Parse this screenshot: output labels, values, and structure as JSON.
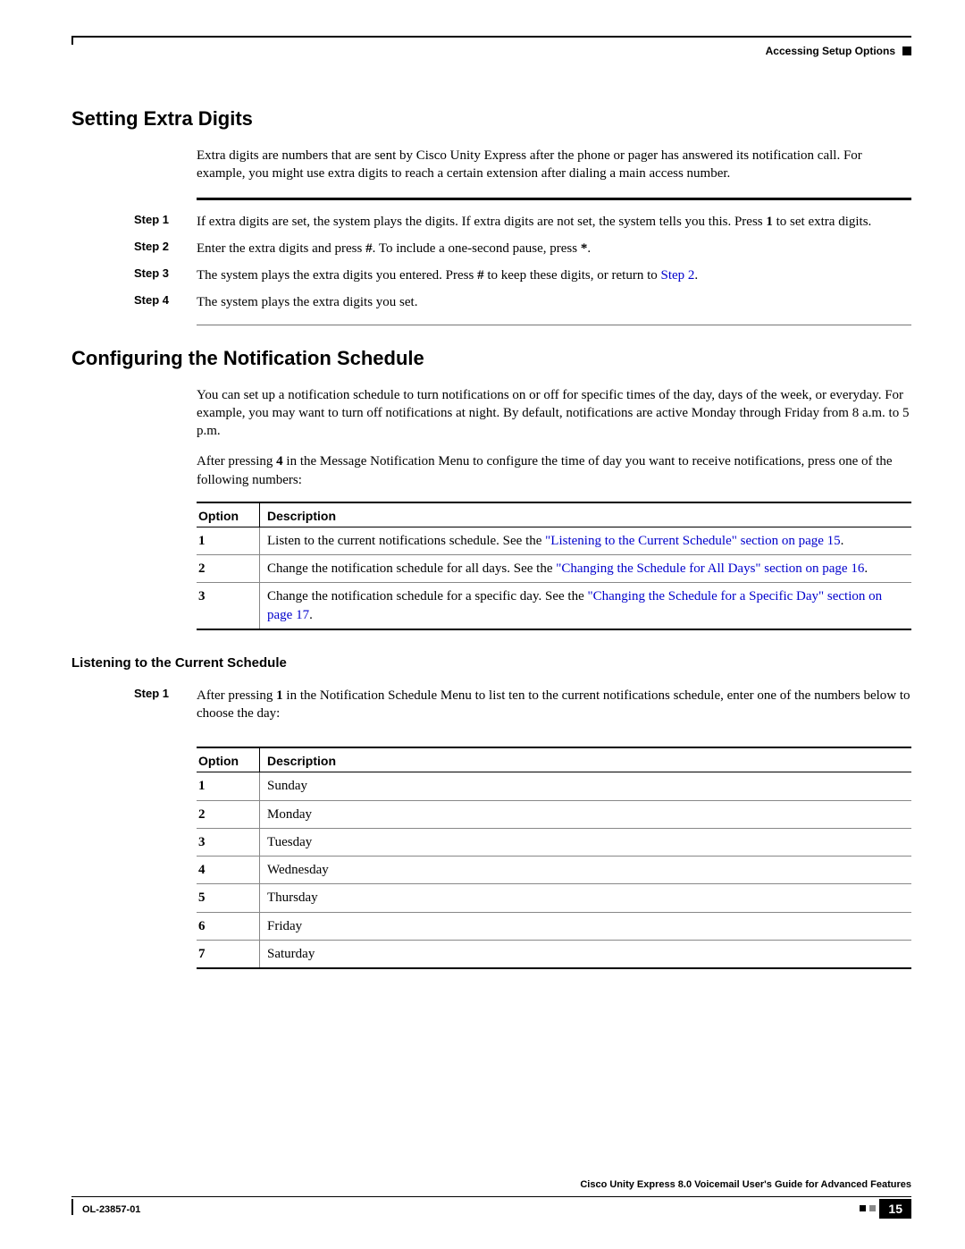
{
  "header": {
    "section": "Accessing Setup Options"
  },
  "h2a": "Setting Extra Digits",
  "p1": "Extra digits are numbers that are sent by Cisco Unity Express after the phone or pager has answered its notification call. For example, you might use extra digits to reach a certain extension after dialing a main access number.",
  "steps_a": {
    "prefix": "Step ",
    "s1": "If extra digits are set, the system plays the digits. If extra digits are not set, the system tells you this. Press 1 to set extra digits.",
    "s2": "Enter the extra digits and press #. To include a one-second pause, press *.",
    "s3_a": "The system plays the extra digits you entered. Press # to keep these digits, or return to ",
    "s3_link": "Step 2",
    "s3_b": ".",
    "s4": "The system plays the extra digits you set."
  },
  "h2b": "Configuring the Notification Schedule",
  "p2": "You can set up a notification schedule to turn notifications on or off for specific times of the day, days of the week, or everyday. For example, you may want to turn off notifications at night. By default, notifications are active Monday through Friday from 8 a.m. to 5 p.m.",
  "p3": "After pressing 4 in the Message Notification Menu to configure the time of day you want to receive notifications, press one of the following numbers:",
  "table1": {
    "h_option": "Option",
    "h_desc": "Description",
    "r1": {
      "opt": "1",
      "a": "Listen to the current notifications schedule. See the ",
      "link": "\"Listening to the Current Schedule\" section on page 15",
      "b": "."
    },
    "r2": {
      "opt": "2",
      "a": "Change the notification schedule for all days. See the ",
      "link": "\"Changing the Schedule for All Days\" section on page 16",
      "b": "."
    },
    "r3": {
      "opt": "3",
      "a": "Change the notification schedule for a specific day. See the ",
      "link": "\"Changing the Schedule for a Specific Day\" section on page 17",
      "b": "."
    }
  },
  "h3": "Listening to the Current Schedule",
  "step_b1": "After pressing 1 in the Notification Schedule Menu to listen to the current notifications schedule, enter one of the numbers below to choose the day:",
  "table2": {
    "h_option": "Option",
    "h_desc": "Description",
    "rows": [
      {
        "opt": "1",
        "desc": "Sunday"
      },
      {
        "opt": "2",
        "desc": "Monday"
      },
      {
        "opt": "3",
        "desc": "Tuesday"
      },
      {
        "opt": "4",
        "desc": "Wednesday"
      },
      {
        "opt": "5",
        "desc": "Thursday"
      },
      {
        "opt": "6",
        "desc": "Friday"
      },
      {
        "opt": "7",
        "desc": "Saturday"
      }
    ]
  },
  "footer": {
    "title": "Cisco Unity Express 8.0 Voicemail User's Guide for Advanced Features",
    "docid": "OL-23857-01",
    "page": "15"
  }
}
